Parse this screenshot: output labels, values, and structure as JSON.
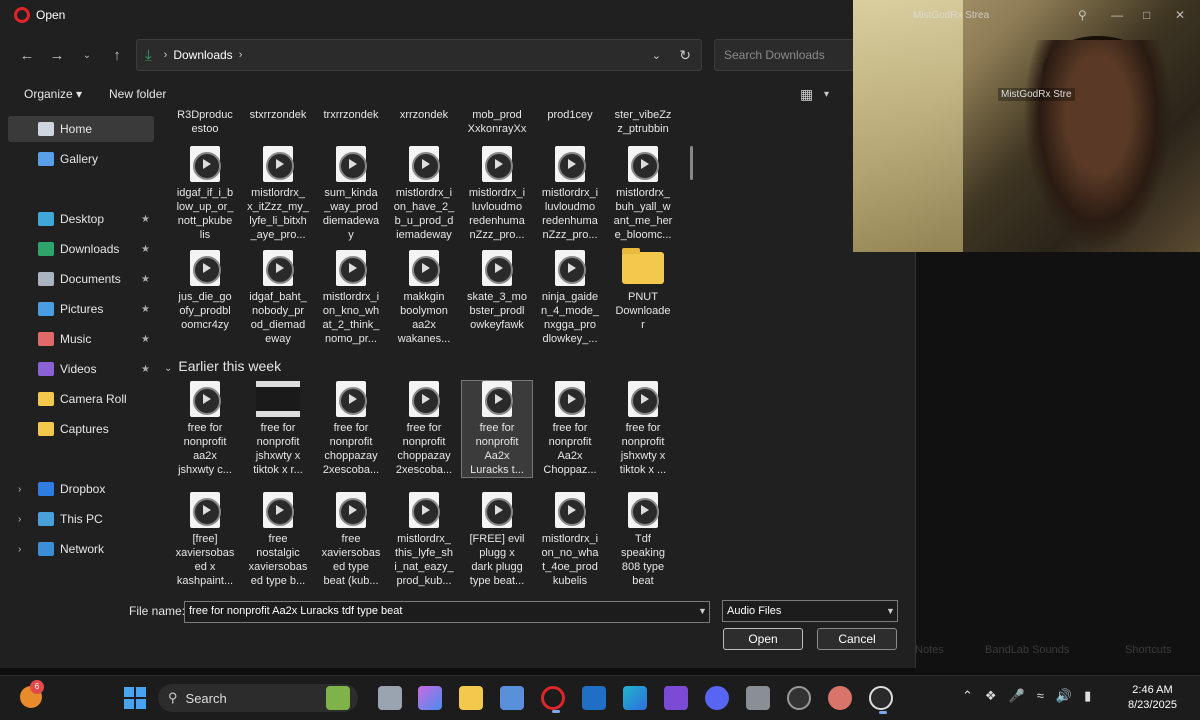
{
  "dialog": {
    "title": "Open",
    "address": {
      "crumb": "Downloads"
    },
    "search_placeholder": "Search Downloads",
    "toolbar": {
      "organize": "Organize",
      "new_folder": "New folder"
    },
    "sidebar": [
      {
        "label": "Home",
        "icon": "home-icon",
        "active": true
      },
      {
        "label": "Gallery",
        "icon": "gallery-icon"
      },
      {
        "label": "Desktop",
        "icon": "desktop-icon",
        "pinned": true
      },
      {
        "label": "Downloads",
        "icon": "download-icon",
        "pinned": true
      },
      {
        "label": "Documents",
        "icon": "documents-icon",
        "pinned": true
      },
      {
        "label": "Pictures",
        "icon": "pictures-icon",
        "pinned": true
      },
      {
        "label": "Music",
        "icon": "music-icon",
        "pinned": true
      },
      {
        "label": "Videos",
        "icon": "videos-icon",
        "pinned": true
      },
      {
        "label": "Camera Roll",
        "icon": "folder-icon"
      },
      {
        "label": "Captures",
        "icon": "folder-icon"
      },
      {
        "label": "Dropbox",
        "icon": "dropbox-icon",
        "expandable": true
      },
      {
        "label": "This PC",
        "icon": "pc-icon",
        "expandable": true
      },
      {
        "label": "Network",
        "icon": "network-icon",
        "expandable": true
      }
    ],
    "top_row": [
      "R3Dproduc\nestoo",
      "stxrrzondek",
      "trxrrzondek",
      "xrrzondek",
      "mob_prod\nXxkonrayXx",
      "prod1cey",
      "ster_vibeZz\nz_ptrubbin"
    ],
    "row1": [
      "idgaf_if_i_b\nlow_up_or_\nnott_pkube\nlis",
      "mistlordrx_\nx_itZzz_my_\nlyfe_li_bitxh\n_aye_pro...",
      "sum_kinda\n_way_prod\ndiemadewa\ny",
      "mistlordrx_i\non_have_2_\nb_u_prod_d\niemadeway",
      "mistlordrx_i\nluvloudmo\nredenhuma\nnZzz_pro...",
      "mistlordrx_i\nluvloudmo\nredenhuma\nnZzz_pro...",
      "mistlordrx_\nbuh_yall_w\nant_me_her\ne_bloomc..."
    ],
    "row2": [
      "jus_die_go\nofy_prodbl\noomcr4zy",
      "idgaf_baht_\nnobody_pr\nod_diemad\neway",
      "mistlordrx_i\non_kno_wh\nat_2_think_\nnomo_pr...",
      "makkgin\nboolymon\naa2x\nwakanes...",
      "skate_3_mo\nbster_prodl\nowkeyfawk",
      "ninja_gaide\nn_4_mode_\nnxgga_pro\ndlowkey_...",
      "PNUT\nDownloade\nr"
    ],
    "group_header": "Earlier this week",
    "row3": [
      "free for\nnonprofit\naa2x\njshxwty c...",
      "free for\nnonprofit\njshxwty x\ntiktok x r...",
      "free for\nnonprofit\nchoppazay\n2xescoba...",
      "free for\nnonprofit\nchoppazay\n2xescoba...",
      "free for\nnonprofit\nAa2x\nLuracks  t...",
      "free for\nnonprofit\nAa2x\nChoppaz...",
      "free for\nnonprofit\njshxwty x\ntiktok x ..."
    ],
    "row4": [
      "[free]\nxaviersobas\ned x\nkashpaint...",
      "free\nnostalgic\nxaviersobas\ned type b...",
      "free\nxaviersobas\ned type\nbeat (kub...",
      "mistlordrx_\nthis_lyfe_sh\ni_nat_eazy_\nprod_kub...",
      "[FREE] evil\nplugg x\ndark plugg\ntype beat...",
      "mistlordrx_i\non_no_wha\nt_4oe_prod\nkubelis",
      "Tdf\nspeaking\n808 type\nbeat"
    ],
    "filename_label": "File name:",
    "filename_value": "free for nonprofit Aa2x  Luracks  tdf type beat",
    "filetype": "Audio Files",
    "open_label": "Open",
    "cancel_label": "Cancel"
  },
  "webcam": {
    "title": "MistGodRx Strea",
    "tab": "MistGodRx Stre"
  },
  "background": {
    "notes": "Notes",
    "bandlab": "BandLab Sounds",
    "shortcuts": "Shortcuts"
  },
  "taskbar": {
    "weather_badge": "6",
    "search_label": "Search",
    "time": "2:46 AM",
    "date": "8/23/2025"
  },
  "colors": {
    "accent": "#4aa3f0",
    "folder": "#f2c94c",
    "download": "#2fa36b"
  }
}
